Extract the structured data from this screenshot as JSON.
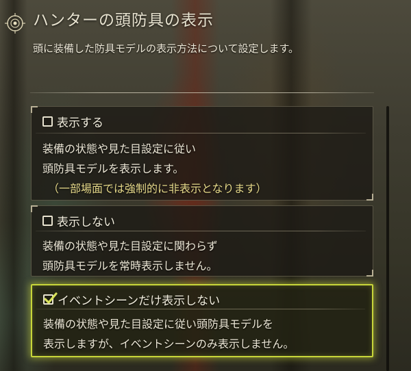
{
  "header": {
    "title": "ハンターの頭防具の表示",
    "description": "頭に装備した防具モデルの表示方法について設定します。"
  },
  "options": [
    {
      "label": "表示する",
      "checked": false,
      "lines": [
        "装備の状態や見た目設定に従い",
        "頭防具モデルを表示します。"
      ],
      "note": "（一部場面では強制的に非表示となります）"
    },
    {
      "label": "表示しない",
      "checked": false,
      "lines": [
        "装備の状態や見た目設定に関わらず",
        "頭防具モデルを常時表示しません。"
      ]
    },
    {
      "label": "イベントシーンだけ表示しない",
      "checked": true,
      "lines": [
        "装備の状態や見た目設定に従い頭防具モデルを",
        "表示しますが、イベントシーンのみ表示しません。"
      ]
    }
  ],
  "colors": {
    "selected_border": "#c8d63a",
    "check_mark": "#d9e35a",
    "note_text": "#e6d98a"
  },
  "icons": {
    "emblem": "circular-emblem-icon",
    "checkbox_checked": "check-icon"
  }
}
